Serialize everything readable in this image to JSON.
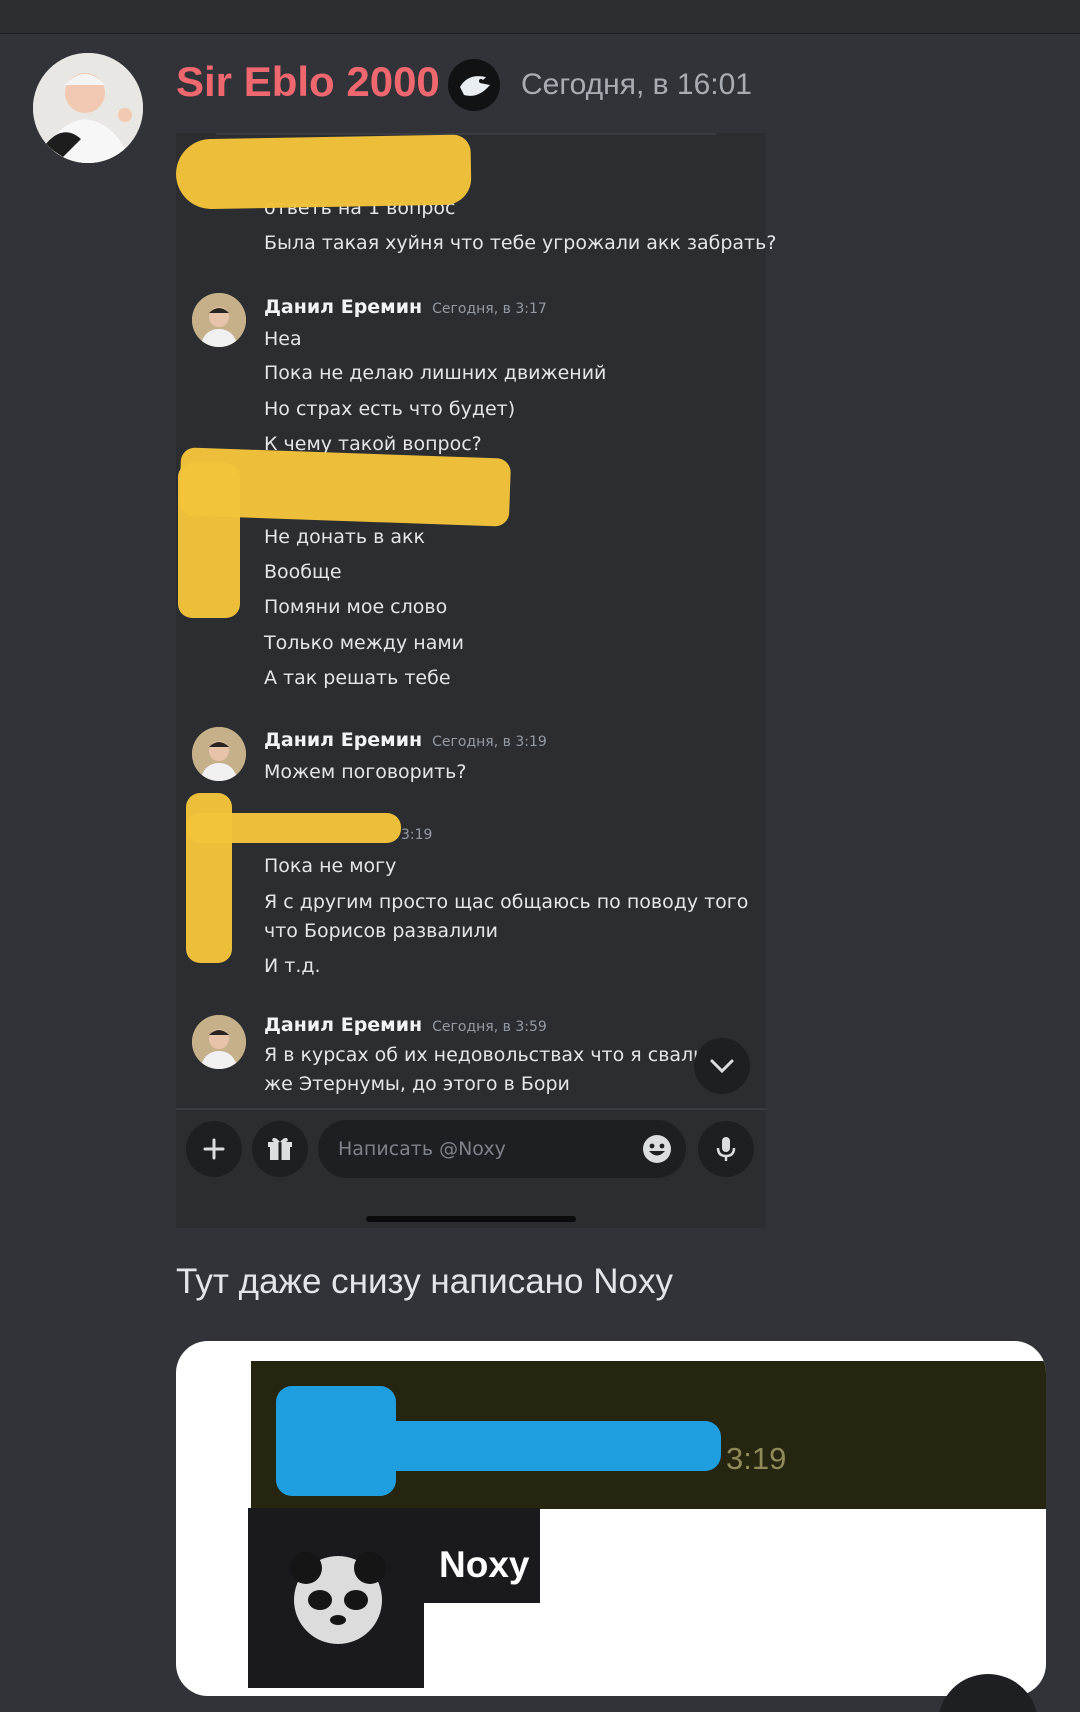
{
  "outer_message": {
    "author": "Sir Eblo 2000",
    "timestamp": "Сегодня, в 16:01"
  },
  "screenshot": {
    "lines_top": [
      "ответь на 1 вопрос",
      "Была такая хуйня что тебе угрожали акк забрать?"
    ],
    "groups": [
      {
        "author": "Данил Еремин",
        "time": "Сегодня, в 3:17",
        "lines": [
          "Неа",
          "Пока не делаю лишних движений",
          "Но страх есть что будет)",
          "К чему такой вопрос?"
        ]
      },
      {
        "author": "Данил Еремин",
        "time": "Сегодня, в 3:19",
        "lines": [
          "Можем поговорить?"
        ]
      },
      {
        "author": "Данил Еремин",
        "time": "Сегодня, в 3:59",
        "lines": [
          "Я в курсах об их недовольствах что я свалил",
          "же Этернумы, до этого в Бори"
        ]
      }
    ],
    "hidden_group_lines": [
      "Не донать в акк",
      "Вообще",
      "Помяни мое слово",
      "Только между нами",
      "А так решать тебе"
    ],
    "hidden_group2_time": "3:19",
    "hidden_group2_lines": [
      "Пока не могу",
      "Я с другим просто щас общаюсь по поводу того",
      "что Борисов развалили",
      "И т.д."
    ],
    "input_placeholder": "Написать @Noxy"
  },
  "caption": "Тут даже снизу написано Noxy",
  "card": {
    "time": "3:19",
    "name": "Noxy"
  },
  "colors": {
    "background": "#313338",
    "author_red": "#f0686f",
    "scribble_yellow": "#f3c33a",
    "scribble_blue": "#1f9fe0"
  },
  "icons": [
    "bot-badge-icon",
    "chevron-down-icon",
    "plus-icon",
    "gift-icon",
    "emoji-icon",
    "microphone-icon"
  ]
}
